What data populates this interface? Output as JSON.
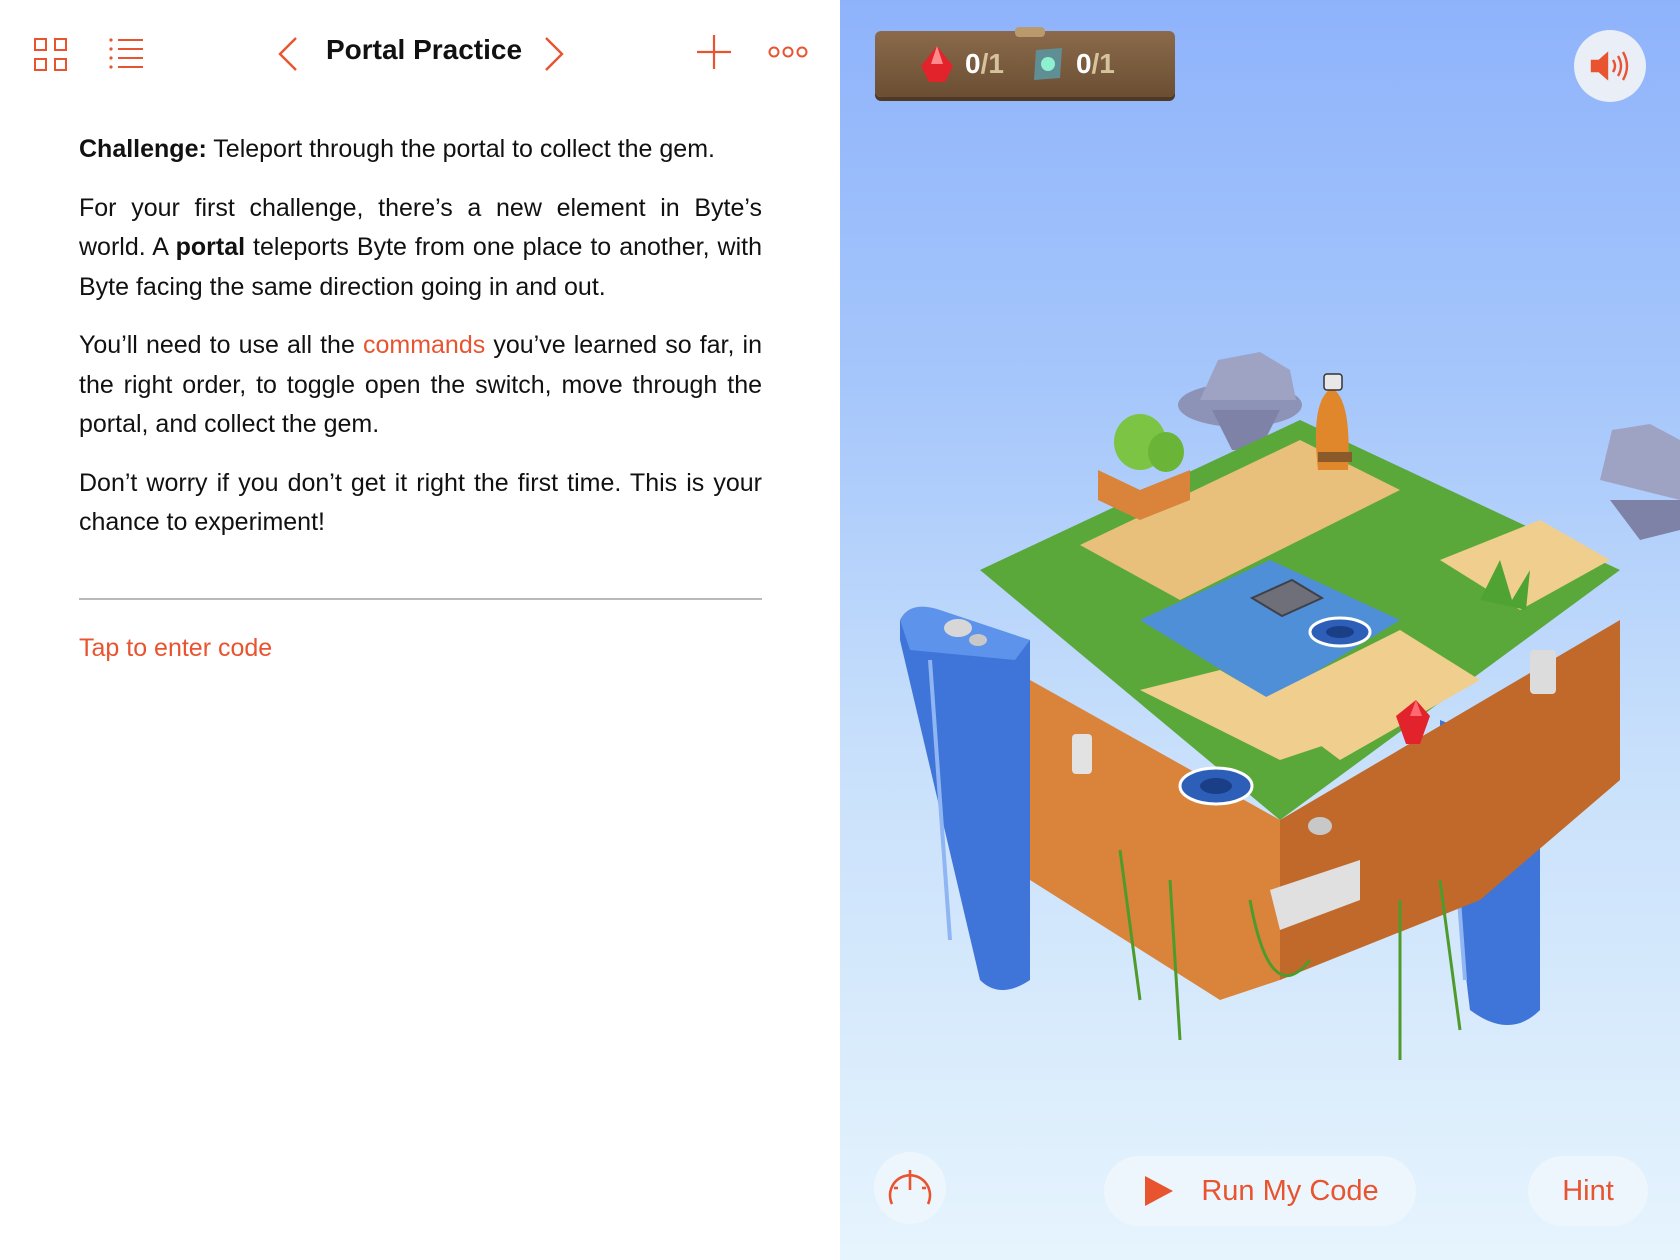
{
  "toolbar": {
    "title": "Portal Practice",
    "icons": [
      "grid-icon",
      "list-icon",
      "chevron-left-icon",
      "chevron-right-icon",
      "plus-icon",
      "more-icon"
    ]
  },
  "content": {
    "p1_bold": "Challenge:",
    "p1_text": " Teleport through the portal to collect the gem.",
    "p2_text1": "For your first challenge, there’s a new element in Byte’s world. A ",
    "p2_bold": "portal",
    "p2_text2": " teleports Byte from one place to another, with Byte facing the same direction going in and out.",
    "p3_text1": "You’ll need to use all the ",
    "p3_link": "commands",
    "p3_text2": " you’ve learned so far, in the right order, to toggle open the switch, move through the portal, and collect the gem.",
    "p4_text": "Don’t worry if you don’t get it right the first time. This is your chance to experiment!",
    "tap_to_enter": "Tap to enter code"
  },
  "scoreboard": {
    "gems": {
      "count": "0",
      "total": "/1"
    },
    "switches": {
      "count": "0",
      "total": "/1"
    }
  },
  "controls": {
    "run_label": "Run My Code",
    "hint_label": "Hint"
  },
  "colors": {
    "accent": "#e8542f",
    "sky_top": "#8fb3fb",
    "sky_bottom": "#e6f4fd"
  }
}
